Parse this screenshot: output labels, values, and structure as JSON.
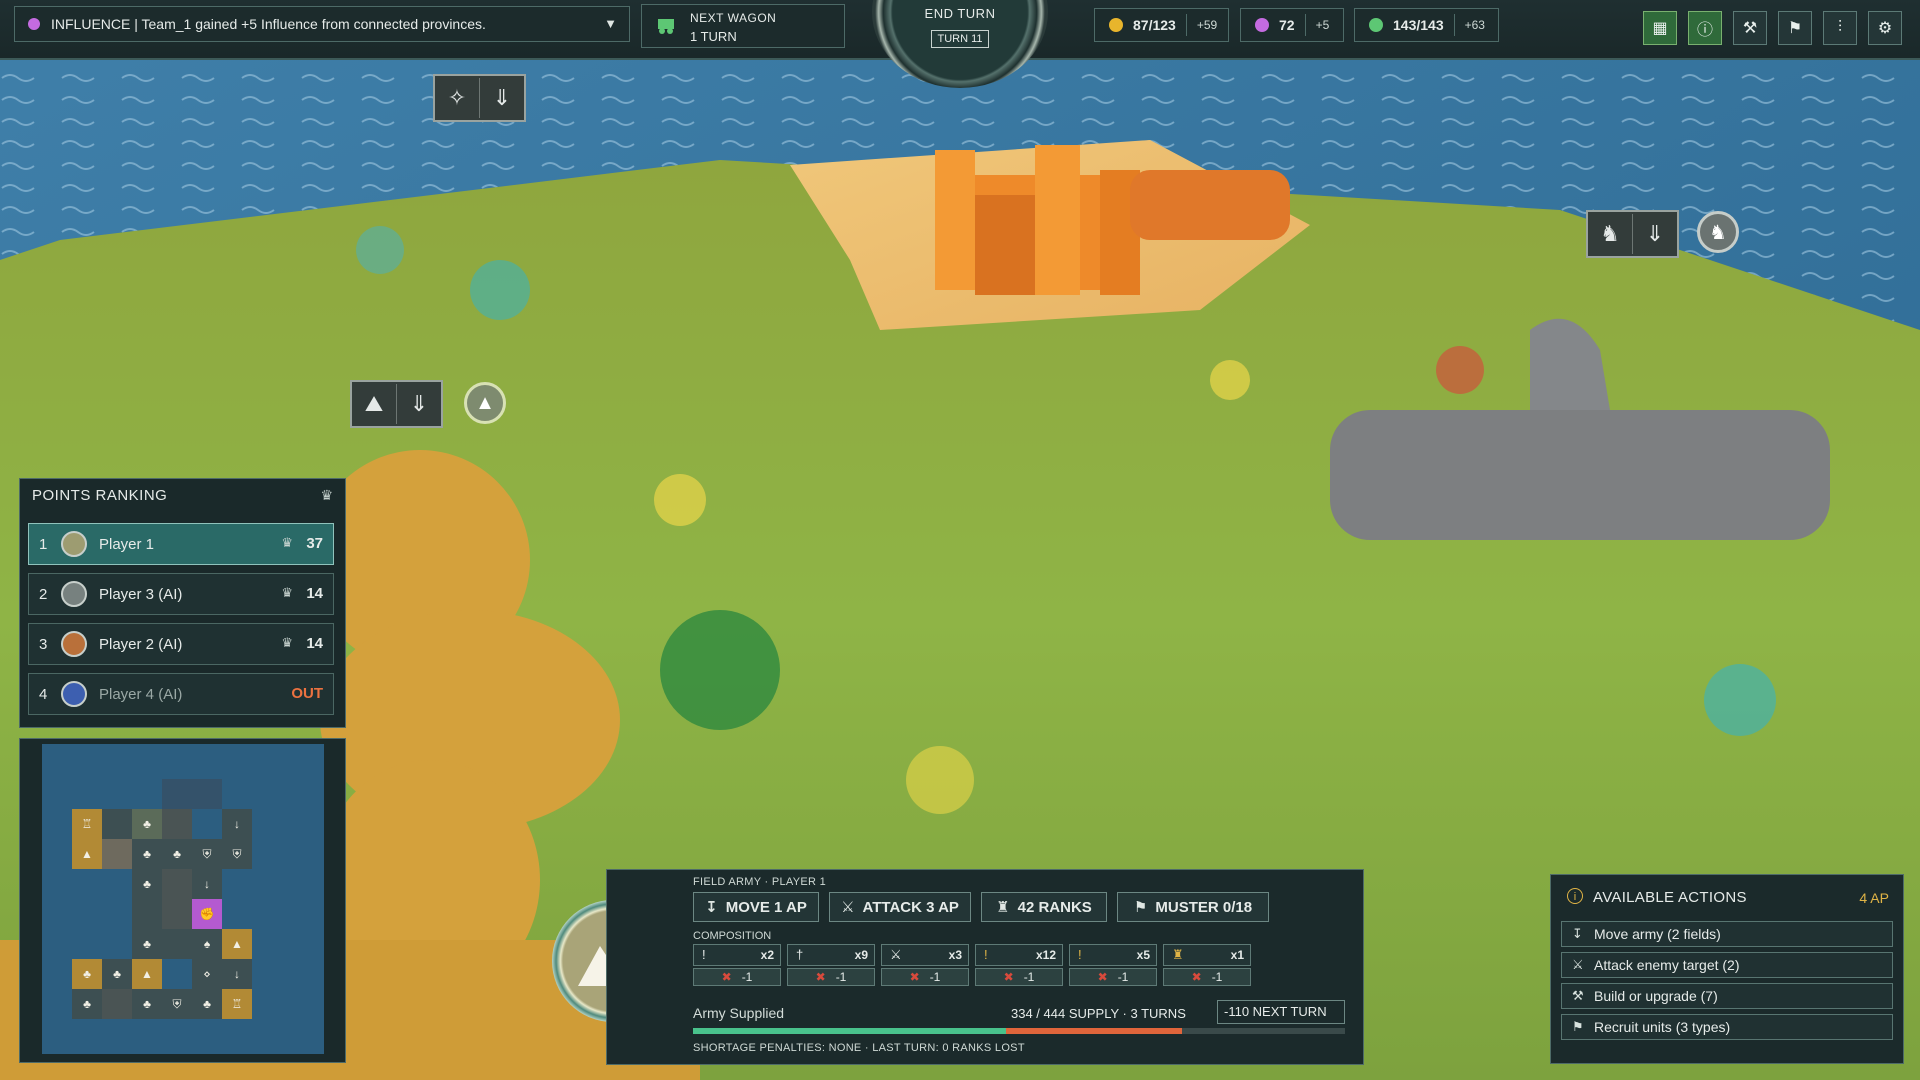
{
  "notification": {
    "icon": "influence-icon",
    "text": "INFLUENCE | Team_1 gained +5 Influence from connected provinces."
  },
  "next_wagon": {
    "title": "NEXT WAGON",
    "value": "1 TURN"
  },
  "end_turn": {
    "label": "END TURN",
    "turn": "TURN 11"
  },
  "resources": [
    {
      "icon": "gold-coin-icon",
      "value": "87/123",
      "delta": "+59",
      "color": "#e8b52c"
    },
    {
      "icon": "influence-fist-icon",
      "value": "72",
      "delta": "+5",
      "color": "#c46be0"
    },
    {
      "icon": "supply-leaf-icon",
      "value": "143/143",
      "delta": "+63",
      "color": "#5dc774"
    }
  ],
  "toolbar": [
    "map-icon",
    "info-icon",
    "build-icon",
    "recruit-icon",
    "stats-icon",
    "settings-icon"
  ],
  "ranking": {
    "title": "POINTS RANKING",
    "rows": [
      {
        "rank": "1",
        "name": "Player 1",
        "points": "37",
        "avatar_color": "#9d9c71",
        "active": true
      },
      {
        "rank": "2",
        "name": "Player 3 (AI)",
        "points": "14",
        "avatar_color": "#77817f",
        "active": false
      },
      {
        "rank": "3",
        "name": "Player 2 (AI)",
        "points": "14",
        "avatar_color": "#b9703a",
        "active": false
      },
      {
        "rank": "4",
        "name": "Player 4 (AI)",
        "points": "OUT",
        "avatar_color": "#3d5fb0",
        "active": false
      }
    ]
  },
  "army": {
    "label": "FIELD ARMY · PLAYER 1",
    "buttons": [
      {
        "icon": "move-icon",
        "label": "MOVE 1 AP"
      },
      {
        "icon": "attack-icon",
        "label": "ATTACK 3 AP"
      },
      {
        "icon": "ranks-icon",
        "label": "42 RANKS"
      },
      {
        "icon": "muster-icon",
        "label": "MUSTER 0/18"
      }
    ],
    "composition_label": "COMPOSITION",
    "units": [
      {
        "icon": "spearman-icon",
        "count": "x2",
        "penalty": "-1",
        "color": "#e6ebe9"
      },
      {
        "icon": "swordsman-icon",
        "count": "x9",
        "penalty": "-1",
        "color": "#e6ebe9"
      },
      {
        "icon": "crossed-swords-icon",
        "count": "x3",
        "penalty": "-1",
        "color": "#e6ebe9"
      },
      {
        "icon": "archer-icon",
        "count": "x12",
        "penalty": "-1",
        "color": "#e0b446"
      },
      {
        "icon": "knight-icon",
        "count": "x5",
        "penalty": "-1",
        "color": "#e0b446"
      },
      {
        "icon": "siege-icon",
        "count": "x1",
        "penalty": "-1",
        "color": "#e0b446"
      }
    ],
    "supply_status": "Army Supplied",
    "supply_value": "334 / 444 SUPPLY · 3 TURNS",
    "supply_fraction": 0.75,
    "next_turn": "-110 NEXT TURN",
    "penalties": "SHORTAGE PENALTIES: NONE · LAST TURN: 0 RANKS LOST"
  },
  "actions": {
    "title": "AVAILABLE ACTIONS",
    "ap": "4 AP",
    "items": [
      {
        "icon": "move-icon",
        "label": "Move army (2 fields)"
      },
      {
        "icon": "attack-icon",
        "label": "Attack enemy target (2)"
      },
      {
        "icon": "build-icon",
        "label": "Build or upgrade (7)"
      },
      {
        "icon": "recruit-icon",
        "label": "Recruit units (3 types)"
      }
    ]
  }
}
